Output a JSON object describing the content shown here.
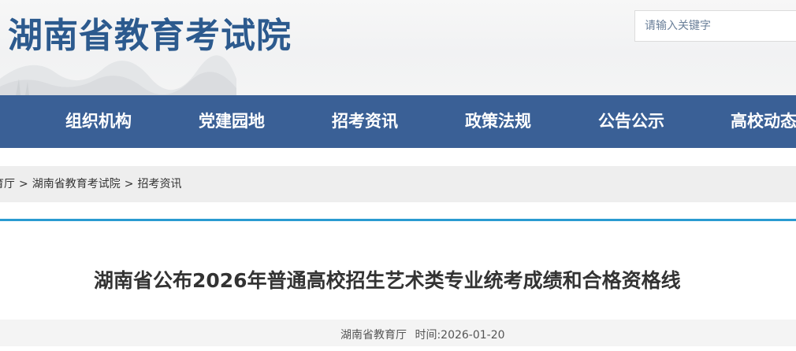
{
  "header": {
    "site_title": "湖南省教育考试院",
    "search": {
      "placeholder": "请输入关键字"
    }
  },
  "nav": {
    "items": [
      {
        "label": "组织机构"
      },
      {
        "label": "党建园地"
      },
      {
        "label": "招考资讯"
      },
      {
        "label": "政策法规"
      },
      {
        "label": "公告公示"
      },
      {
        "label": "高校动态"
      }
    ]
  },
  "breadcrumb": {
    "items": [
      "育厅",
      "湖南省教育考试院",
      "招考资讯"
    ],
    "separator": ">"
  },
  "article": {
    "title": "湖南省公布2026年普通高校招生艺术类专业统考成绩和合格资格线",
    "source": "湖南省教育厅",
    "time_label": "时间:",
    "date": "2026-01-20"
  },
  "colors": {
    "brand_blue": "#2c5a8e",
    "nav_background": "#3a6096",
    "accent_rule": "#2a9bd1"
  }
}
